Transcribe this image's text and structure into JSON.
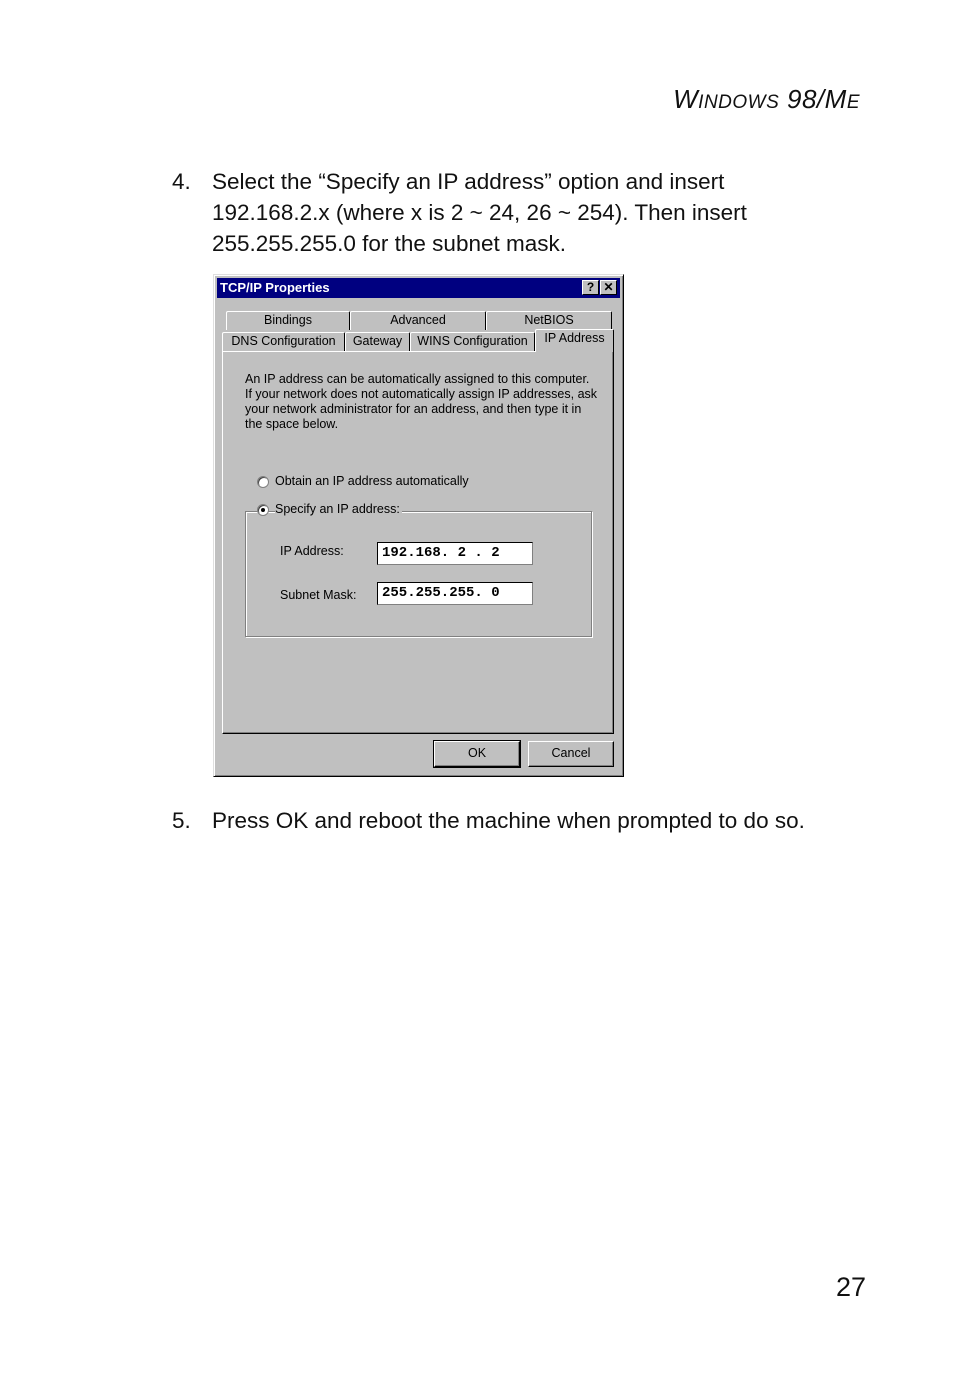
{
  "header": {
    "running_head_prefix_cap": "W",
    "running_head_prefix_sc": "INDOWS",
    "running_head_mid": " 98/M",
    "running_head_suffix_sc": "E"
  },
  "steps": [
    {
      "number": "4.",
      "text": "Select the “Specify an IP address” option and insert\n192.168.2.x (where x is 2 ~ 24, 26 ~ 254). Then insert\n255.255.255.0 for the subnet mask."
    },
    {
      "number": "5.",
      "text": "Press OK and reboot the machine when prompted to do so."
    }
  ],
  "dialog": {
    "title": "TCP/IP Properties",
    "help_button": "?",
    "close_button": "✕",
    "tabs_row1": [
      "Bindings",
      "Advanced",
      "NetBIOS"
    ],
    "tabs_row2": [
      "DNS Configuration",
      "Gateway",
      "WINS Configuration",
      "IP Address"
    ],
    "active_tab": "IP Address",
    "description": "An IP address can be automatically assigned to this computer.\nIf your network does not automatically assign IP addresses, ask\nyour network administrator for an address, and then type it in\nthe space below.",
    "radio_obtain": {
      "label": "Obtain an IP address automatically",
      "checked": false
    },
    "radio_specify": {
      "label": "Specify an IP address:",
      "checked": true
    },
    "ip_address": {
      "label": "IP Address:",
      "value": "192.168. 2 . 2"
    },
    "subnet_mask": {
      "label": "Subnet Mask:",
      "value": "255.255.255. 0"
    },
    "ok_label": "OK",
    "cancel_label": "Cancel"
  },
  "footer": {
    "page_number": "27"
  }
}
